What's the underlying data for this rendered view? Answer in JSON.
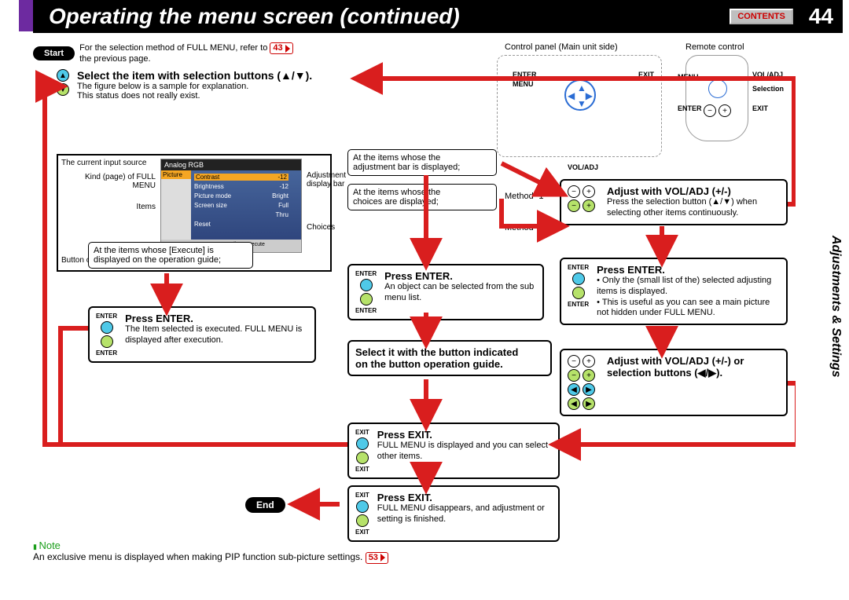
{
  "page": {
    "title": "Operating the menu screen (continued)",
    "contents_btn": "CONTENTS",
    "page_number": "44",
    "section_tab": "Adjustments & Settings"
  },
  "start": {
    "label": "Start",
    "text1": "For the selection method of FULL MENU, refer to",
    "ref": "43",
    "text2": "the previous page."
  },
  "step_select": {
    "title": "Select the item with selection buttons (▲/▼).",
    "line1": "The figure below is a sample for explanation.",
    "line2": "This status does not really exist."
  },
  "fig": {
    "border_label": "",
    "current_src": "The current input source",
    "kind": "Kind (page) of FULL MENU",
    "items": "Items",
    "guide": "Button operation guide",
    "adj_bar": "Adjustment display bar",
    "choices": "Choices",
    "screen_title": "Analog RGB",
    "sidebar_item": "Picture",
    "row_contrast": "Contrast",
    "row_brightness": "Brightness",
    "row_picmode": "Picture mode",
    "row_scrsize": "Screen size",
    "row_reset": "Reset",
    "val_m12a": "-12",
    "val_m12b": "-12",
    "val_bright": "Bright",
    "val_full": "Full",
    "val_thru": "Thru",
    "bottom_bar": "GUIDE   ▶◀Page   ▲▼Item   Adjust   Execute"
  },
  "cond_adj": {
    "l1": "At the items whose the",
    "l2": "adjustment bar is displayed;"
  },
  "cond_choice": {
    "l1": "At the items whose the",
    "l2": "choices are displayed;"
  },
  "cond_exec": {
    "l1": "At the items whose [Execute] is",
    "l2": "displayed on the operation guide;"
  },
  "method1": "Method -1",
  "method2": "Method -2",
  "voladj_top": {
    "title": "Adjust with VOL/ADJ (+/-)",
    "line": "Press the selection button (▲/▼) when selecting other items continuously."
  },
  "press_enter_exec": {
    "title": "Press ENTER.",
    "line": "The Item selected is executed.  FULL MENU is displayed after execution."
  },
  "press_enter_sub": {
    "title": "Press ENTER.",
    "line": "An object can be selected from the sub menu list."
  },
  "press_enter_small": {
    "title": "Press ENTER.",
    "l1": "Only the (small list of the) selected adjusting items is displayed.",
    "l2": "This is useful as you can see a main picture not hidden under FULL MENU."
  },
  "select_guide": {
    "l1": "Select it with the button indicated",
    "l2": "on the button operation guide."
  },
  "voladj_sel": {
    "l1": "Adjust with VOL/ADJ (+/-) or",
    "l2": "selection buttons (◀/▶)."
  },
  "press_exit1": {
    "title": "Press EXIT.",
    "line": "FULL MENU is displayed and you can select other items."
  },
  "press_exit2": {
    "title": "Press EXIT.",
    "line": "FULL MENU disappears, and adjustment or setting is finished."
  },
  "end_label": "End",
  "note": {
    "label": "Note",
    "text": "An exclusive menu is displayed when making PIP function sub-picture settings.",
    "ref": "53"
  },
  "diagrams": {
    "control_panel": "Control panel (Main unit side)",
    "remote": "Remote control",
    "enter": "ENTER",
    "exit": "EXIT",
    "menu": "MENU",
    "voladj": "VOL/ADJ",
    "selection": "Selection"
  },
  "btn_labels": {
    "enter": "ENTER",
    "exit": "EXIT"
  }
}
